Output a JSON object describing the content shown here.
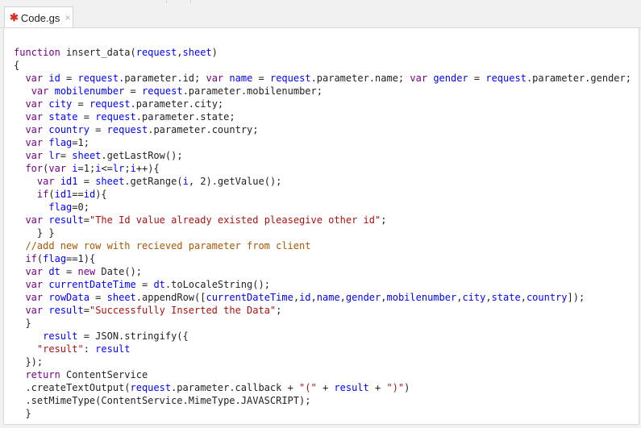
{
  "tab": {
    "label": "Code.gs",
    "modified_marker": "✱",
    "close_glyph": "×"
  },
  "colors": {
    "keyword": "#770088",
    "variable": "#0000ff",
    "string": "#aa1111",
    "comment": "#aa5500",
    "text": "#222222",
    "modified_marker": "#d93025"
  },
  "code_lines": [
    [
      [
        "kw",
        "function"
      ],
      [
        "tx",
        " insert_data("
      ],
      [
        "vd",
        "request"
      ],
      [
        "tx",
        ","
      ],
      [
        "vd",
        "sheet"
      ],
      [
        "tx",
        ")"
      ]
    ],
    [
      [
        "tx",
        "{"
      ]
    ],
    [
      [
        "tx",
        "  "
      ],
      [
        "kw",
        "var"
      ],
      [
        "tx",
        " "
      ],
      [
        "vd",
        "id"
      ],
      [
        "tx",
        " = "
      ],
      [
        "vd",
        "request"
      ],
      [
        "tx",
        ".parameter.id; "
      ],
      [
        "kw",
        "var"
      ],
      [
        "tx",
        " "
      ],
      [
        "vd",
        "name"
      ],
      [
        "tx",
        " = "
      ],
      [
        "vd",
        "request"
      ],
      [
        "tx",
        ".parameter.name; "
      ],
      [
        "kw",
        "var"
      ],
      [
        "tx",
        " "
      ],
      [
        "vd",
        "gender"
      ],
      [
        "tx",
        " = "
      ],
      [
        "vd",
        "request"
      ],
      [
        "tx",
        ".parameter.gender;"
      ]
    ],
    [
      [
        "tx",
        "   "
      ],
      [
        "kw",
        "var"
      ],
      [
        "tx",
        " "
      ],
      [
        "vd",
        "mobilenumber"
      ],
      [
        "tx",
        " = "
      ],
      [
        "vd",
        "request"
      ],
      [
        "tx",
        ".parameter.mobilenumber;"
      ]
    ],
    [
      [
        "tx",
        "  "
      ],
      [
        "kw",
        "var"
      ],
      [
        "tx",
        " "
      ],
      [
        "vd",
        "city"
      ],
      [
        "tx",
        " = "
      ],
      [
        "vd",
        "request"
      ],
      [
        "tx",
        ".parameter.city;"
      ]
    ],
    [
      [
        "tx",
        "  "
      ],
      [
        "kw",
        "var"
      ],
      [
        "tx",
        " "
      ],
      [
        "vd",
        "state"
      ],
      [
        "tx",
        " = "
      ],
      [
        "vd",
        "request"
      ],
      [
        "tx",
        ".parameter.state;"
      ]
    ],
    [
      [
        "tx",
        "  "
      ],
      [
        "kw",
        "var"
      ],
      [
        "tx",
        " "
      ],
      [
        "vd",
        "country"
      ],
      [
        "tx",
        " = "
      ],
      [
        "vd",
        "request"
      ],
      [
        "tx",
        ".parameter.country;"
      ]
    ],
    [
      [
        "tx",
        "  "
      ],
      [
        "kw",
        "var"
      ],
      [
        "tx",
        " "
      ],
      [
        "vd",
        "flag"
      ],
      [
        "tx",
        "=1;"
      ]
    ],
    [
      [
        "tx",
        "  "
      ],
      [
        "kw",
        "var"
      ],
      [
        "tx",
        " "
      ],
      [
        "vd",
        "lr"
      ],
      [
        "tx",
        "= "
      ],
      [
        "vd",
        "sheet"
      ],
      [
        "tx",
        ".getLastRow();"
      ]
    ],
    [
      [
        "tx",
        "  "
      ],
      [
        "kw",
        "for"
      ],
      [
        "tx",
        "("
      ],
      [
        "kw",
        "var"
      ],
      [
        "tx",
        " "
      ],
      [
        "vd",
        "i"
      ],
      [
        "tx",
        "=1;"
      ],
      [
        "vd",
        "i"
      ],
      [
        "tx",
        "<="
      ],
      [
        "vd",
        "lr"
      ],
      [
        "tx",
        ";"
      ],
      [
        "vd",
        "i"
      ],
      [
        "tx",
        "++){"
      ]
    ],
    [
      [
        "tx",
        "    "
      ],
      [
        "kw",
        "var"
      ],
      [
        "tx",
        " "
      ],
      [
        "vd",
        "id1"
      ],
      [
        "tx",
        " = "
      ],
      [
        "vd",
        "sheet"
      ],
      [
        "tx",
        ".getRange("
      ],
      [
        "vd",
        "i"
      ],
      [
        "tx",
        ", 2).getValue();"
      ]
    ],
    [
      [
        "tx",
        "    "
      ],
      [
        "kw",
        "if"
      ],
      [
        "tx",
        "("
      ],
      [
        "vd",
        "id1"
      ],
      [
        "tx",
        "=="
      ],
      [
        "vd",
        "id"
      ],
      [
        "tx",
        "){"
      ]
    ],
    [
      [
        "tx",
        "      "
      ],
      [
        "vd",
        "flag"
      ],
      [
        "tx",
        "=0;"
      ]
    ],
    [
      [
        "tx",
        "  "
      ],
      [
        "kw",
        "var"
      ],
      [
        "tx",
        " "
      ],
      [
        "vd",
        "result"
      ],
      [
        "tx",
        "="
      ],
      [
        "str",
        "\"The Id value already existed pleasegive other id\""
      ],
      [
        "tx",
        ";"
      ]
    ],
    [
      [
        "tx",
        "    } }"
      ]
    ],
    [
      [
        "tx",
        "  "
      ],
      [
        "cm",
        "//add new row with recieved parameter from client"
      ]
    ],
    [
      [
        "tx",
        "  "
      ],
      [
        "kw",
        "if"
      ],
      [
        "tx",
        "("
      ],
      [
        "vd",
        "flag"
      ],
      [
        "tx",
        "==1){"
      ]
    ],
    [
      [
        "tx",
        "  "
      ],
      [
        "kw",
        "var"
      ],
      [
        "tx",
        " "
      ],
      [
        "vd",
        "dt"
      ],
      [
        "tx",
        " = "
      ],
      [
        "kw",
        "new"
      ],
      [
        "tx",
        " Date();"
      ]
    ],
    [
      [
        "tx",
        "  "
      ],
      [
        "kw",
        "var"
      ],
      [
        "tx",
        " "
      ],
      [
        "vd",
        "currentDateTime"
      ],
      [
        "tx",
        " = "
      ],
      [
        "vd",
        "dt"
      ],
      [
        "tx",
        ".toLocaleString();"
      ]
    ],
    [
      [
        "tx",
        "  "
      ],
      [
        "kw",
        "var"
      ],
      [
        "tx",
        " "
      ],
      [
        "vd",
        "rowData"
      ],
      [
        "tx",
        " = "
      ],
      [
        "vd",
        "sheet"
      ],
      [
        "tx",
        ".appendRow(["
      ],
      [
        "vd",
        "currentDateTime"
      ],
      [
        "tx",
        ","
      ],
      [
        "vd",
        "id"
      ],
      [
        "tx",
        ","
      ],
      [
        "vd",
        "name"
      ],
      [
        "tx",
        ","
      ],
      [
        "vd",
        "gender"
      ],
      [
        "tx",
        ","
      ],
      [
        "vd",
        "mobilenumber"
      ],
      [
        "tx",
        ","
      ],
      [
        "vd",
        "city"
      ],
      [
        "tx",
        ","
      ],
      [
        "vd",
        "state"
      ],
      [
        "tx",
        ","
      ],
      [
        "vd",
        "country"
      ],
      [
        "tx",
        "]);"
      ]
    ],
    [
      [
        "tx",
        "  "
      ],
      [
        "kw",
        "var"
      ],
      [
        "tx",
        " "
      ],
      [
        "vd",
        "result"
      ],
      [
        "tx",
        "="
      ],
      [
        "str",
        "\"Successfully Inserted the Data\""
      ],
      [
        "tx",
        ";"
      ]
    ],
    [
      [
        "tx",
        "  }"
      ]
    ],
    [
      [
        "tx",
        "     "
      ],
      [
        "vd",
        "result"
      ],
      [
        "tx",
        " = JSON.stringify({"
      ]
    ],
    [
      [
        "tx",
        "    "
      ],
      [
        "str",
        "\"result\""
      ],
      [
        "tx",
        ": "
      ],
      [
        "vd",
        "result"
      ]
    ],
    [
      [
        "tx",
        "  });"
      ]
    ],
    [
      [
        "tx",
        "  "
      ],
      [
        "kw",
        "return"
      ],
      [
        "tx",
        " ContentService"
      ]
    ],
    [
      [
        "tx",
        "  .createTextOutput("
      ],
      [
        "vd",
        "request"
      ],
      [
        "tx",
        ".parameter.callback + "
      ],
      [
        "str",
        "\"(\""
      ],
      [
        "tx",
        " + "
      ],
      [
        "vd",
        "result"
      ],
      [
        "tx",
        " + "
      ],
      [
        "str",
        "\")\""
      ],
      [
        "tx",
        ")"
      ]
    ],
    [
      [
        "tx",
        "  .setMimeType(ContentService.MimeType.JAVASCRIPT);"
      ]
    ],
    [
      [
        "tx",
        "  }"
      ]
    ]
  ]
}
